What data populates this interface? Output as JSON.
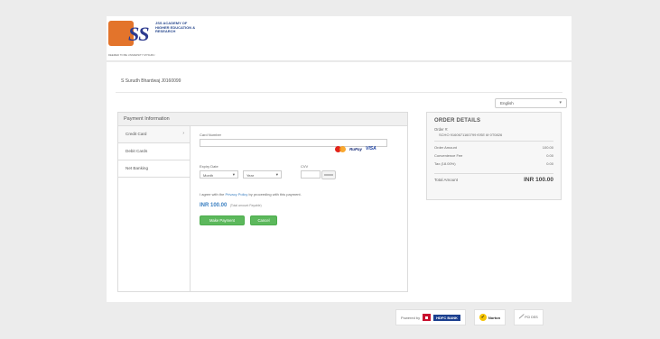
{
  "header": {
    "logo_text": "JSS Academy of Higher Education & Research",
    "logo_tagline": "DEEMED TO BE UNIVERSITY    MYSURU"
  },
  "student": {
    "name": "S Surudh Bhardwaj J0160099"
  },
  "language": {
    "selected": "English"
  },
  "payment": {
    "title": "Payment Information",
    "tabs": [
      {
        "label": "Credit Card",
        "active": true
      },
      {
        "label": "Debit Cards",
        "active": false
      },
      {
        "label": "Net Banking",
        "active": false
      }
    ],
    "card_number_label": "Card Number",
    "card_logos": {
      "rupay": "RuPay",
      "visa": "VISA"
    },
    "expiry_label": "Expiry Date",
    "month_placeholder": "Month",
    "year_placeholder": "Year",
    "cvv_label": "CVV",
    "agree_prefix": "I agree with the ",
    "agree_link": "Privacy Policy",
    "agree_suffix": " by proceeding with this payment.",
    "amount": "INR 100.00",
    "amount_note": "(Total amount Payable)",
    "pay_button": "Make Payment",
    "cancel_button": "Cancel"
  },
  "order": {
    "title": "ORDER DETAILS",
    "order_id_label": "Order #:",
    "order_id": "SCHO 9160671160799 f0SE 6f 0T0826",
    "rows": [
      {
        "label": "Order Amount",
        "value": "100.00"
      },
      {
        "label": "Convenience Fee",
        "value": "0.00"
      },
      {
        "label": "Tax (18.00%)",
        "value": "0.00"
      }
    ],
    "total_label": "Total Amount",
    "total_value": "INR 100.00"
  },
  "footer": {
    "powered_by": "Powered by",
    "bank": "HDFC BANK",
    "norton": "Norton",
    "pci": "PCI DSS"
  },
  "colors": {
    "accent_blue": "#3a7fc1",
    "button_green": "#5cb85c",
    "brand_orange": "#e3742b",
    "brand_blue": "#2c3a8f"
  }
}
